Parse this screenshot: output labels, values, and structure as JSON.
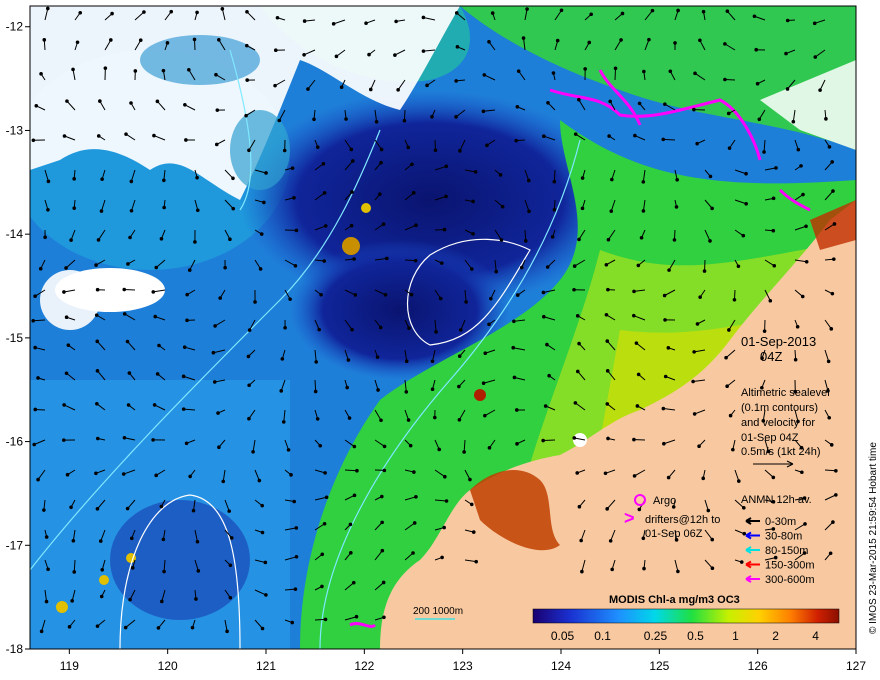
{
  "axes": {
    "x_ticks": [
      "119",
      "120",
      "121",
      "122",
      "123",
      "124",
      "125",
      "126",
      "127"
    ],
    "y_ticks": [
      "-12",
      "-13",
      "-14",
      "-15",
      "-16",
      "-17",
      "-18"
    ],
    "x_range": [
      118.6,
      127.0
    ],
    "y_range": [
      -18.0,
      -11.8
    ]
  },
  "info": {
    "date": "01-Sep-2013",
    "time": "04Z",
    "altimetry_lines": [
      "Altimetric sealevel",
      "(0.1m contours)",
      "and velocity for",
      "01-Sep 04Z",
      "0.5m/s (1kt 24h)"
    ]
  },
  "legend": {
    "argo": "Argo",
    "drifters": [
      "drifters@12h to",
      "01-Sep 06Z"
    ],
    "anmn_title": "ANMN 12h av.",
    "depths": [
      {
        "label": "0-30m",
        "color": "#000000"
      },
      {
        "label": "30-80m",
        "color": "#0000ff"
      },
      {
        "label": "80-150m",
        "color": "#00e0e0"
      },
      {
        "label": "150-300m",
        "color": "#ff0000"
      },
      {
        "label": "300-600m",
        "color": "#ff00ff"
      }
    ]
  },
  "scale_bar": {
    "label": "200  1000m"
  },
  "colorbar": {
    "title": "MODIS Chl-a mg/m3 OC3",
    "ticks": [
      "0.05",
      "0.1",
      "0.25",
      "0.5",
      "1",
      "2",
      "4"
    ]
  },
  "credit": "© IMOS 23-Mar-2015 21:59:54 Hobart time",
  "colors": {
    "land": "#f8c9a0",
    "low_chl": "#0a1f7a",
    "mid_chl": "#1e88e5",
    "high_chl": "#3ad63a",
    "cloud": "#ffffff",
    "argo": "#ff00ff"
  }
}
